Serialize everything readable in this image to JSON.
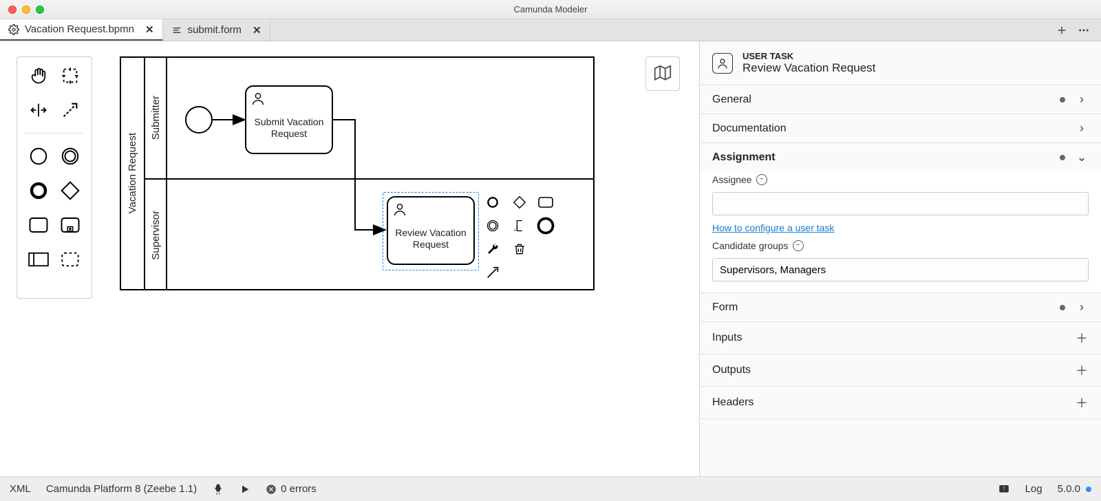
{
  "window": {
    "title": "Camunda Modeler"
  },
  "tabs": [
    {
      "label": "Vacation Request.bpmn",
      "icon": "gear-icon",
      "active": true
    },
    {
      "label": "submit.form",
      "icon": "form-icon",
      "active": false
    }
  ],
  "diagram": {
    "pool_name": "Vacation Request",
    "lanes": [
      {
        "name": "Submitter"
      },
      {
        "name": "Supervisor"
      }
    ],
    "tasks": [
      {
        "name": "Submit Vacation Request"
      },
      {
        "name": "Review Vacation Request"
      }
    ]
  },
  "properties": {
    "type_label": "USER TASK",
    "name": "Review Vacation Request",
    "sections": {
      "general": "General",
      "documentation": "Documentation",
      "assignment": "Assignment",
      "form": "Form",
      "inputs": "Inputs",
      "outputs": "Outputs",
      "headers": "Headers"
    },
    "assignment": {
      "assignee_label": "Assignee",
      "assignee_value": "",
      "help_link": "How to configure a user task",
      "candidate_groups_label": "Candidate groups",
      "candidate_groups_value": "Supervisors, Managers"
    }
  },
  "statusbar": {
    "xml": "XML",
    "platform": "Camunda Platform 8 (Zeebe 1.1)",
    "errors": "0 errors",
    "log": "Log",
    "version": "5.0.0"
  }
}
